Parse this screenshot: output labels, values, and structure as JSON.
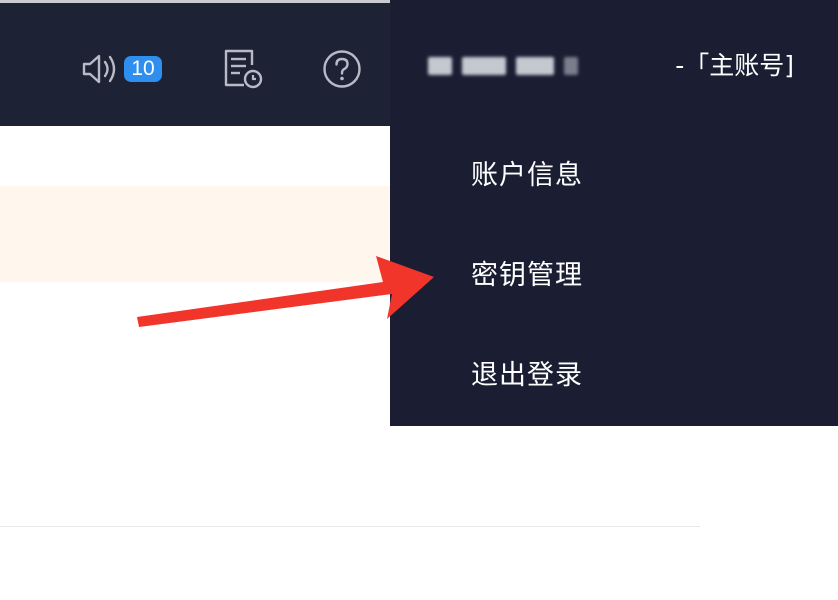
{
  "header": {
    "notification_count": "10",
    "account_role": "-「主账号]"
  },
  "dropdown": {
    "items": [
      {
        "label": "账户信息"
      },
      {
        "label": "密钥管理"
      },
      {
        "label": "退出登录"
      }
    ]
  },
  "colors": {
    "topbar": "#1e2235",
    "dropdown": "#1b1e33",
    "badge": "#2e8ff0",
    "notice_strip": "#fff7ed",
    "annotation_arrow": "#f1352b"
  }
}
